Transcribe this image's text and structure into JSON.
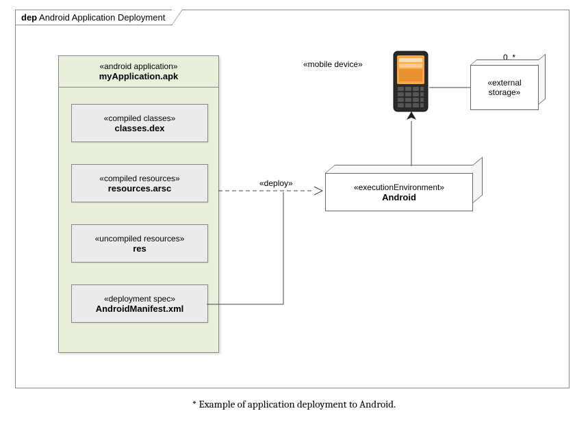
{
  "frame": {
    "prefix": "dep",
    "title": "Android Application Deployment"
  },
  "apk": {
    "stereo": "«android application»",
    "name": "myApplication.apk"
  },
  "artifacts": [
    {
      "stereo": "«compiled classes»",
      "name": "classes.dex"
    },
    {
      "stereo": "«compiled resources»",
      "name": "resources.arsc"
    },
    {
      "stereo": "«uncompiled resources»",
      "name": "res"
    },
    {
      "stereo": "«deployment spec»",
      "name": "AndroidManifest.xml"
    }
  ],
  "mobile": {
    "label": "«mobile device»"
  },
  "extStorage": {
    "multiplicity": "0..*",
    "stereo": "«external",
    "stereo2": "storage»"
  },
  "android": {
    "stereo": "«executionEnvironment»",
    "name": "Android"
  },
  "deploy": {
    "label": "«deploy»"
  },
  "caption": "* Example of application deployment to Android."
}
